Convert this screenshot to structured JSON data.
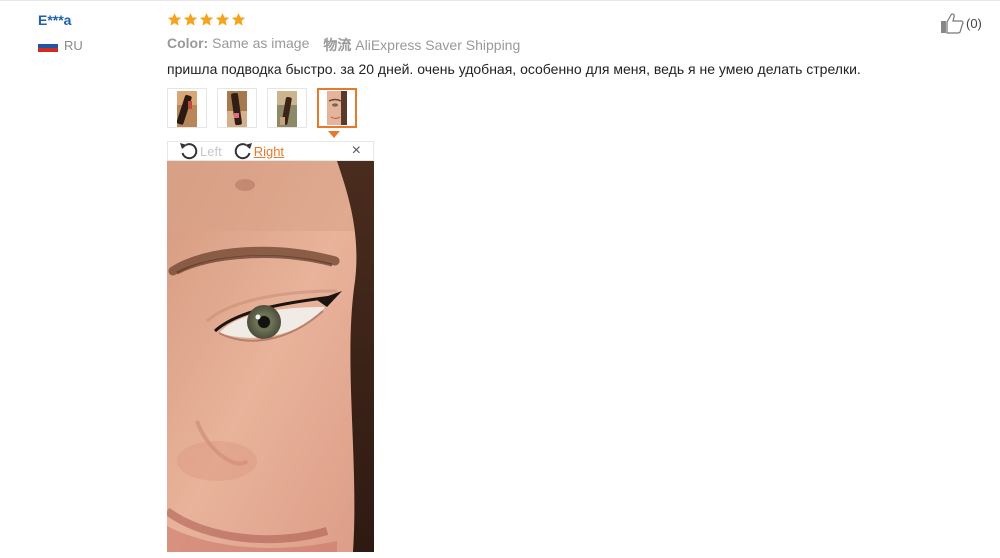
{
  "reviewer": {
    "name": "E***a",
    "country": "RU",
    "flag_colors": [
      "#ffffff",
      "#1c57a5",
      "#d52b1e"
    ]
  },
  "review": {
    "rating": 5,
    "star_color": "#f7a21b",
    "color_label": "Color:",
    "color_value": "Same as image",
    "shipping_label": "物流",
    "shipping_value": "AliExpress Saver Shipping",
    "text": "пришла подводка быстро. за 20 дней. очень удобная, особенно для меня, ведь я не умею делать стрелки."
  },
  "thumbnails": {
    "count": 4,
    "active_index": 3
  },
  "viewer": {
    "rotate_left_label": "Left",
    "rotate_right_label": "Right",
    "close_symbol": "×"
  },
  "helpful": {
    "count_text": "(0)"
  },
  "colors": {
    "accent": "#e6792e",
    "link": "#1f5fae"
  }
}
